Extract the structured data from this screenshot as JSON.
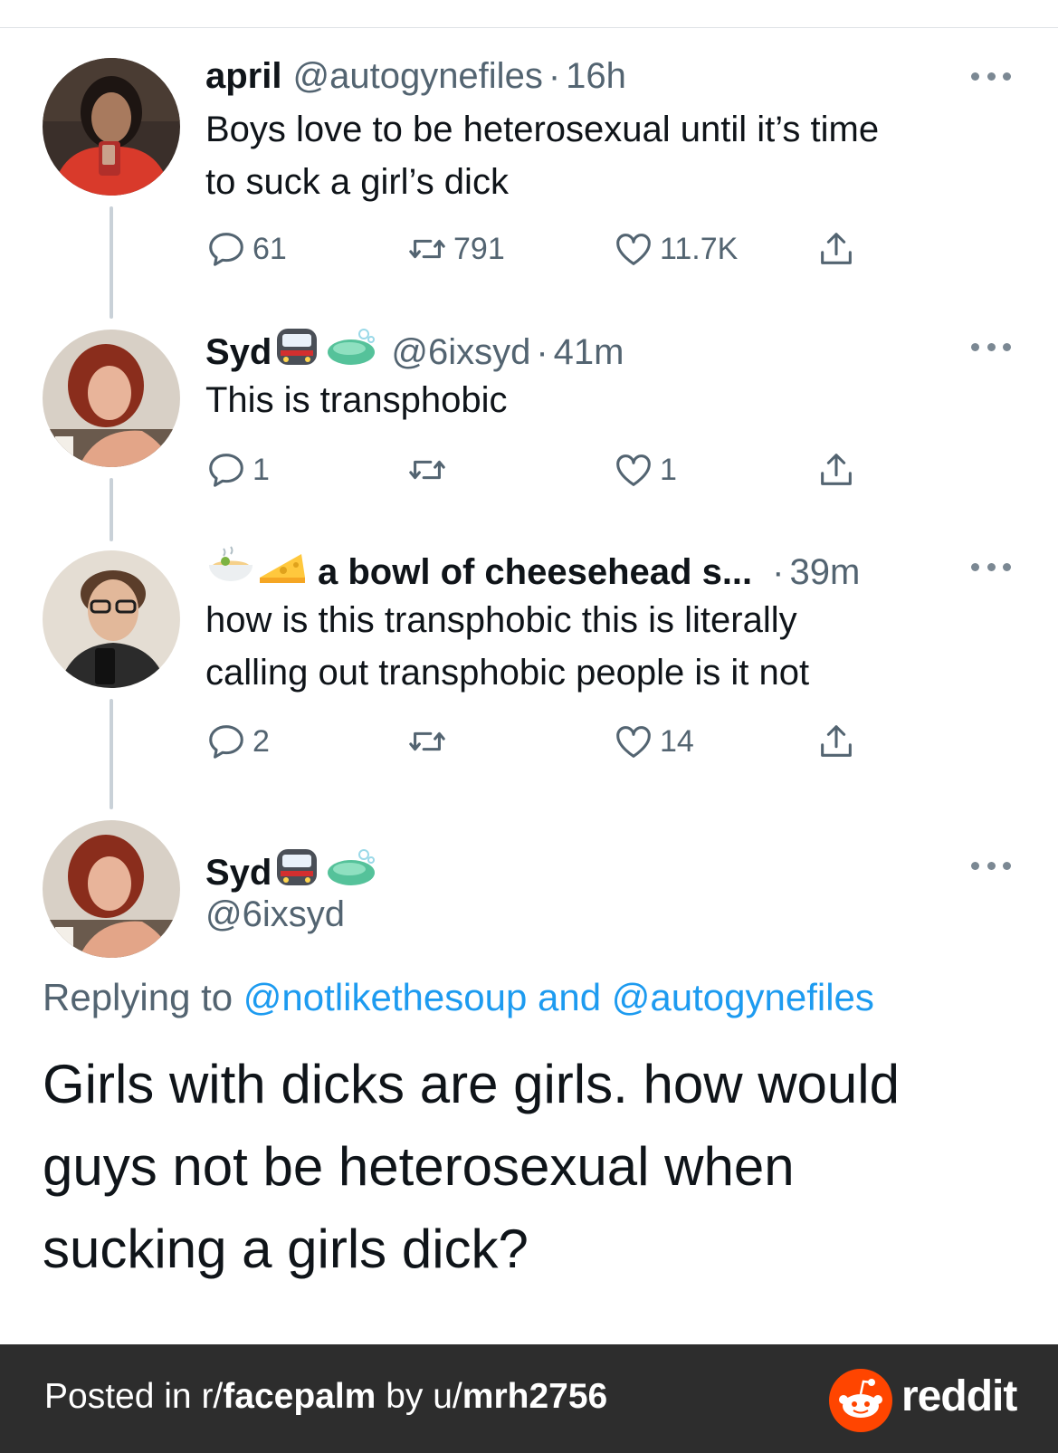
{
  "tweets": [
    {
      "name": "april",
      "handle": "@autogynefiles",
      "sep": "·",
      "time": "16h",
      "text_lines": [
        "Boys love to be heterosexual until it’s time",
        "to suck a girl’s dick"
      ],
      "replies": "61",
      "retweets": "791",
      "likes": "11.7K"
    },
    {
      "name": "Syd",
      "handle": "@6ixsyd",
      "sep": "·",
      "time": "41m",
      "text_lines": [
        "This is transphobic"
      ],
      "replies": "1",
      "retweets": "",
      "likes": "1"
    },
    {
      "name": "a bowl of cheesehead s...",
      "handle": "",
      "sep": "·",
      "time": "39m",
      "text_lines": [
        "how is this transphobic this is literally",
        "calling out transphobic people is it not"
      ],
      "replies": "2",
      "retweets": "",
      "likes": "14"
    }
  ],
  "main_tweet": {
    "name": "Syd",
    "handle": "@6ixsyd",
    "replying_prefix": "Replying to",
    "replying_user1": "@notlikethesoup",
    "replying_and": "and",
    "replying_user2": "@autogynefiles",
    "text_lines": [
      "Girls with dicks are girls. how would",
      "guys not be heterosexual when",
      "sucking a girls dick?"
    ]
  },
  "footer": {
    "posted_in": "Posted in r/",
    "subreddit": "facepalm",
    "by": "by u/",
    "user": "mrh2756",
    "brand": "reddit"
  },
  "colors": {
    "text": "#0f1419",
    "muted": "#536471",
    "link": "#1d9bf0",
    "footer_bg": "#2d2d2d",
    "reddit_orange": "#ff4500"
  }
}
